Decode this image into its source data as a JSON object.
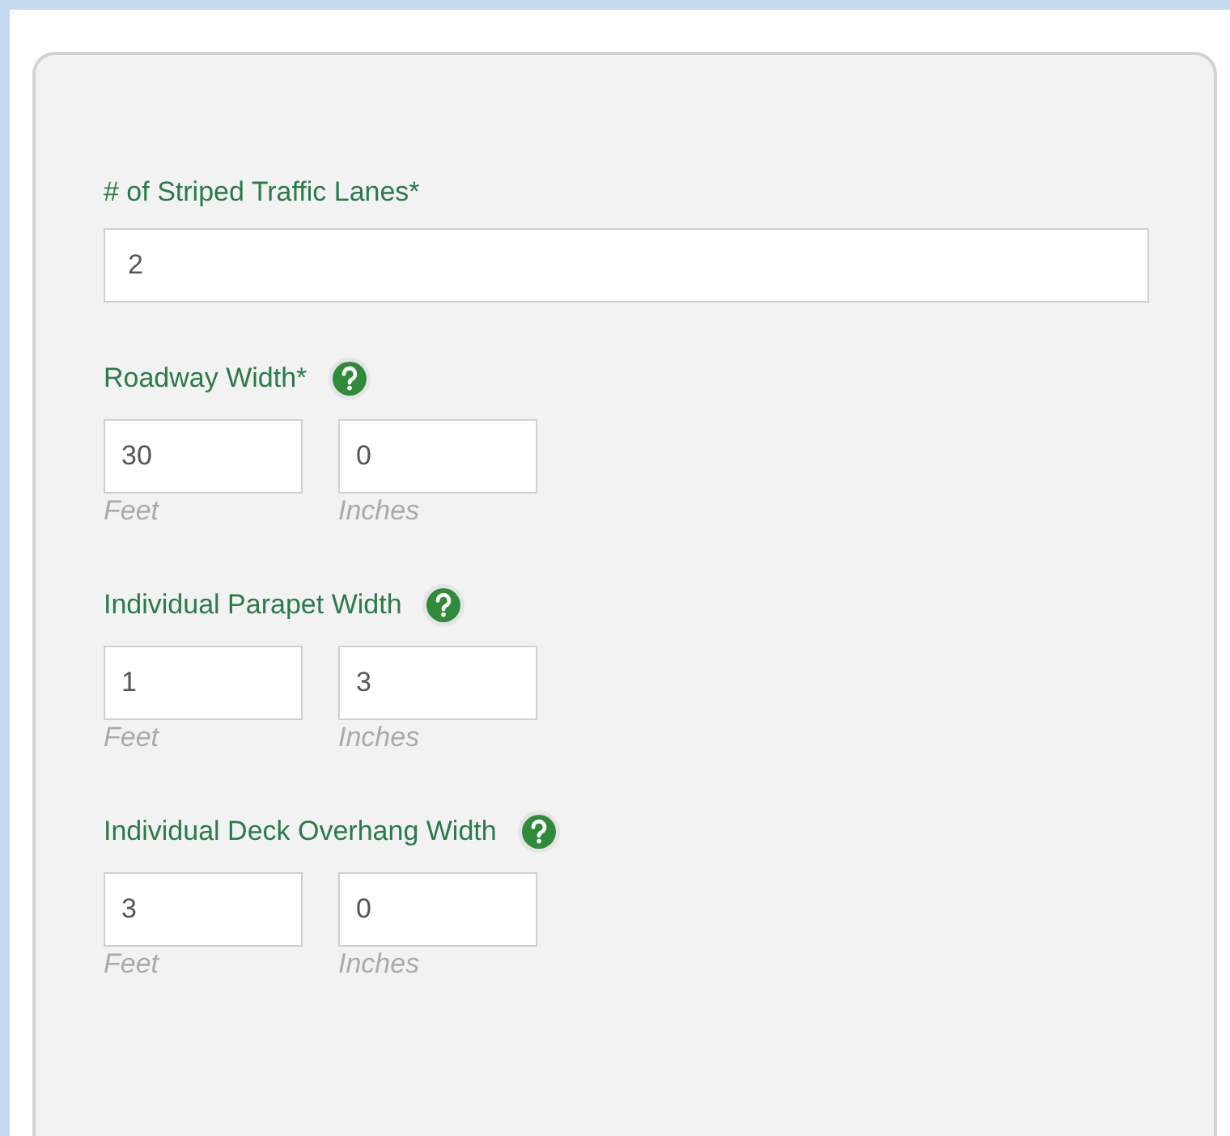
{
  "fields": [
    {
      "kind": "single",
      "label": "# of Striped Traffic Lanes*",
      "help": false,
      "value": "2"
    },
    {
      "kind": "dimension",
      "label": "Roadway Width*",
      "help": true,
      "parts": [
        {
          "value": "30",
          "unit": "Feet"
        },
        {
          "value": "0",
          "unit": "Inches"
        }
      ]
    },
    {
      "kind": "dimension",
      "label": "Individual Parapet Width",
      "help": true,
      "parts": [
        {
          "value": "1",
          "unit": "Feet"
        },
        {
          "value": "3",
          "unit": "Inches"
        }
      ]
    },
    {
      "kind": "dimension",
      "label": "Individual Deck Overhang Width",
      "help": true,
      "parts": [
        {
          "value": "3",
          "unit": "Feet"
        },
        {
          "value": "0",
          "unit": "Inches"
        }
      ]
    }
  ]
}
